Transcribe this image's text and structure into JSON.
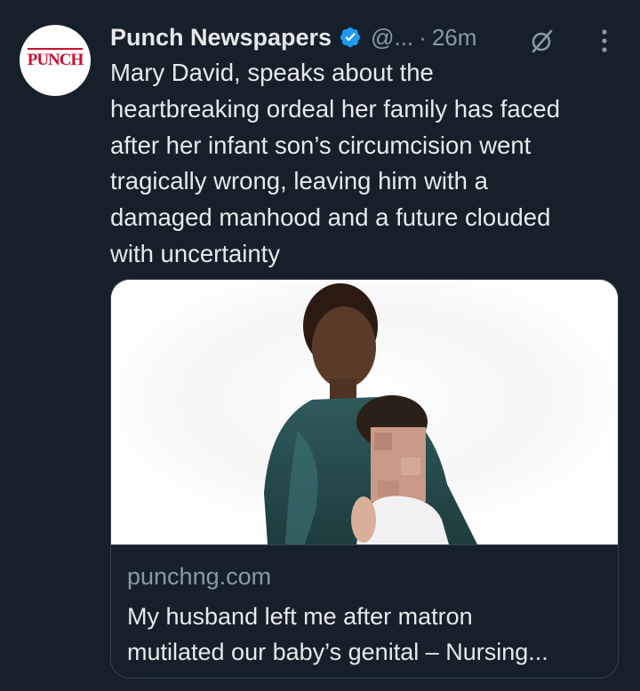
{
  "account": {
    "display_name": "Punch Newspapers",
    "handle": "@...",
    "separator": "·",
    "time": "26m",
    "avatar_text": "PUNCH",
    "verified_icon": "verified-badge-icon",
    "grok_icon": "grok-icon",
    "more_icon": "more-options-icon"
  },
  "tweet": {
    "text": "Mary David, speaks about the\nheartbreaking ordeal her family has faced\nafter her infant son’s circumcision went\ntragically wrong, leaving him with a\ndamaged manhood and a future clouded\nwith uncertainty"
  },
  "card": {
    "domain": "punchng.com",
    "title": "My husband left me after matron\nmutilated our baby’s genital – Nursing..."
  },
  "colors": {
    "background": "#15202b",
    "text_primary": "#e7e9ea",
    "text_secondary": "#8b98a5",
    "verified_blue": "#1d9bf0",
    "border": "#38444d",
    "brand_red": "#c8102e"
  }
}
